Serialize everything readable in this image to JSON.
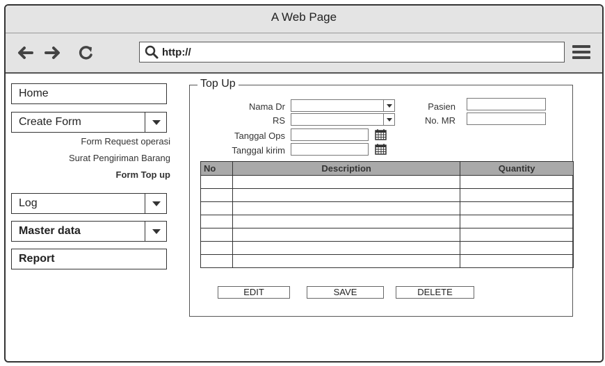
{
  "window": {
    "title": "A Web Page"
  },
  "toolbar": {
    "address_value": "http://"
  },
  "sidebar": {
    "home_label": "Home",
    "create_form_label": "Create Form",
    "sub_items": [
      "Form Request operasi",
      "Surat Pengiriman Barang",
      "Form Top up"
    ],
    "log_label": "Log",
    "master_data_label": "Master data",
    "report_label": "Report"
  },
  "form": {
    "legend": "Top Up",
    "nama_dr_label": "Nama Dr",
    "rs_label": "RS",
    "tanggal_ops_label": "Tanggal Ops",
    "tanggal_kirim_label": "Tanggal kirim",
    "pasien_label": "Pasien",
    "no_mr_label": "No. MR"
  },
  "table": {
    "headers": [
      "No",
      "Description",
      "Quantity"
    ],
    "empty_rows": 7
  },
  "actions": {
    "edit_label": "EDIT",
    "save_label": "SAVE",
    "delete_label": "DELETE"
  },
  "colors": {
    "chrome": "#e4e4e4",
    "table_header": "#a9a9a9",
    "border": "#333333"
  }
}
